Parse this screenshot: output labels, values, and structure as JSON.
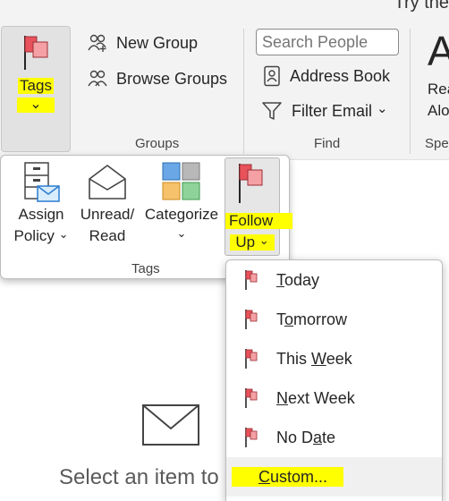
{
  "top_hint": "Try the",
  "ribbon": {
    "tags_button": {
      "label": "Tags",
      "chevron": "⌄"
    },
    "groups": {
      "new_group": "New Group",
      "browse_groups": "Browse Groups",
      "label": "Groups"
    },
    "find": {
      "search_placeholder": "Search People",
      "address_book": "Address Book",
      "filter_email": "Filter Email",
      "filter_chevron": "⌄",
      "label": "Find"
    },
    "speech": {
      "icon_letter": "A",
      "read_aloud_line1": "Rea",
      "read_aloud_line2": "Alo",
      "label": "Spe"
    }
  },
  "tags_panel": {
    "assign_policy": {
      "line1": "Assign",
      "line2": "Policy",
      "chevron": "⌄"
    },
    "unread_read": {
      "line1": "Unread/",
      "line2": "Read"
    },
    "categorize": {
      "label": "Categorize",
      "chevron": "⌄"
    },
    "follow_up": {
      "line1": "Follow",
      "line2": "Up",
      "chevron": "⌄"
    },
    "group_label": "Tags"
  },
  "follow_up_menu": {
    "items": [
      {
        "pre": "",
        "u": "T",
        "post": "oday"
      },
      {
        "pre": "T",
        "u": "o",
        "post": "morrow"
      },
      {
        "pre": "This ",
        "u": "W",
        "post": "eek"
      },
      {
        "pre": "",
        "u": "N",
        "post": "ext Week"
      },
      {
        "pre": "No D",
        "u": "a",
        "post": "te"
      },
      {
        "pre": "",
        "u": "C",
        "post": "ustom..."
      }
    ]
  },
  "reading_pane": {
    "message": "Select an item to"
  },
  "colors": {
    "flag_red": "#e8525a",
    "flag_pink": "#f4a0a4",
    "highlight": "#ffff00",
    "category_blue": "#6aa7e6",
    "category_gray": "#b8b8b8",
    "category_orange": "#f6c26b",
    "category_green": "#8fd39a"
  },
  "icons": {
    "tags": "flag-icon",
    "new_group": "people-plus-icon",
    "browse_groups": "people-icon",
    "address_book": "address-book-icon",
    "filter_email": "funnel-icon",
    "assign_policy": "cabinet-mail-icon",
    "unread_read": "envelope-open-icon",
    "categorize": "category-squares-icon",
    "follow_up": "flag-icon",
    "menu_item": "small-flag-icon",
    "reading_pane": "envelope-icon"
  }
}
